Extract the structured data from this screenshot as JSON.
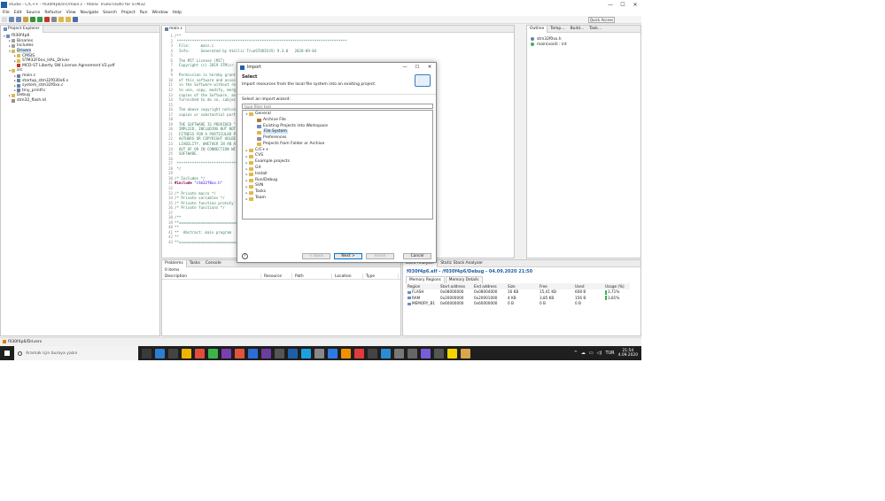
{
  "window": {
    "title": "studio - C/C++ - f030f4p6/src/main.c - Atollic TrueSTUDIO for STM32",
    "minimize": "—",
    "maximize": "☐",
    "close": "✕"
  },
  "menu": [
    "File",
    "Edit",
    "Source",
    "Refactor",
    "View",
    "Navigate",
    "Search",
    "Project",
    "Run",
    "Window",
    "Help"
  ],
  "quick_access": "Quick Access",
  "project_explorer": {
    "tab_label": "Project Explorer",
    "tree": [
      {
        "indent": 0,
        "twisty": "▾",
        "label": "f030f4p6",
        "icon": "project-icon",
        "color": "#6b8cc7"
      },
      {
        "indent": 1,
        "twisty": "▸",
        "label": "Binaries",
        "icon": "binaries-icon",
        "color": "#a0a0a0"
      },
      {
        "indent": 1,
        "twisty": "▸",
        "label": "Includes",
        "icon": "includes-icon",
        "color": "#a0a0a0"
      },
      {
        "indent": 1,
        "twisty": "▾",
        "label": "Drivers",
        "icon": "folder-icon",
        "color": "#e0b84a",
        "selected": true
      },
      {
        "indent": 2,
        "twisty": "▸",
        "label": "CMSIS",
        "icon": "folder-icon",
        "color": "#e0b84a"
      },
      {
        "indent": 2,
        "twisty": "▸",
        "label": "STM32F0xx_HAL_Driver",
        "icon": "folder-icon",
        "color": "#e0b84a"
      },
      {
        "indent": 2,
        "twisty": "",
        "label": "MCD-ST Liberty SW License Agreement V2.pdf",
        "icon": "pdf-icon",
        "color": "#c0392b"
      },
      {
        "indent": 1,
        "twisty": "▾",
        "label": "src",
        "icon": "folder-icon",
        "color": "#e0b84a"
      },
      {
        "indent": 2,
        "twisty": "▸",
        "label": "main.c",
        "icon": "c-file-icon",
        "color": "#6a7fa8"
      },
      {
        "indent": 2,
        "twisty": "▸",
        "label": "startup_stm32f030x6.s",
        "icon": "asm-file-icon",
        "color": "#6a7fa8"
      },
      {
        "indent": 2,
        "twisty": "▸",
        "label": "system_stm32f0xx.c",
        "icon": "c-file-icon",
        "color": "#6a7fa8"
      },
      {
        "indent": 2,
        "twisty": "▸",
        "label": "tiny_printf.c",
        "icon": "c-file-icon",
        "color": "#6a7fa8"
      },
      {
        "indent": 1,
        "twisty": "▸",
        "label": "Debug",
        "icon": "folder-icon",
        "color": "#e0b84a"
      },
      {
        "indent": 1,
        "twisty": "",
        "label": "stm32_flash.ld",
        "icon": "ld-file-icon",
        "color": "#8f8f8f"
      }
    ]
  },
  "editor": {
    "tab_label": "main.c",
    "lines": [
      {
        "n": "1",
        "parts": [
          {
            "c": "cm",
            "t": "/**"
          }
        ]
      },
      {
        "n": "2",
        "parts": [
          {
            "c": "cm",
            "t": " ******************************************************************************"
          }
        ]
      },
      {
        "n": "3",
        "parts": [
          {
            "c": "cm",
            "t": "  File:     main.c"
          }
        ]
      },
      {
        "n": "4",
        "parts": [
          {
            "c": "cm",
            "t": "  Info:     Generated by Atollic TrueSTUDIO(R) 9.3.0   2020-09-04"
          }
        ]
      },
      {
        "n": "5",
        "parts": [
          {
            "c": "cm",
            "t": ""
          }
        ]
      },
      {
        "n": "6",
        "parts": [
          {
            "c": "cm",
            "t": "  The MIT License (MIT)"
          }
        ]
      },
      {
        "n": "7",
        "parts": [
          {
            "c": "cm",
            "t": "  Copyright (c) 2019 STMicr"
          }
        ]
      },
      {
        "n": "8",
        "parts": [
          {
            "c": "cm",
            "t": ""
          }
        ]
      },
      {
        "n": "9",
        "parts": [
          {
            "c": "cm",
            "t": "  Permission is hereby grant"
          }
        ]
      },
      {
        "n": "10",
        "parts": [
          {
            "c": "cm",
            "t": "  of this software and assoc"
          }
        ]
      },
      {
        "n": "11",
        "parts": [
          {
            "c": "cm",
            "t": "  in the Software without re"
          }
        ]
      },
      {
        "n": "12",
        "parts": [
          {
            "c": "cm",
            "t": "  to use, copy, modify, merg"
          }
        ]
      },
      {
        "n": "13",
        "parts": [
          {
            "c": "cm",
            "t": "  copies of the Software, an"
          }
        ]
      },
      {
        "n": "14",
        "parts": [
          {
            "c": "cm",
            "t": "  furnished to do so, subjec"
          }
        ]
      },
      {
        "n": "15",
        "parts": [
          {
            "c": "cm",
            "t": ""
          }
        ]
      },
      {
        "n": "16",
        "parts": [
          {
            "c": "cm",
            "t": "  The above copyright notice"
          }
        ]
      },
      {
        "n": "17",
        "parts": [
          {
            "c": "cm",
            "t": "  copies or substantial port"
          }
        ]
      },
      {
        "n": "18",
        "parts": [
          {
            "c": "cm",
            "t": ""
          }
        ]
      },
      {
        "n": "19",
        "parts": [
          {
            "c": "cm",
            "t": "  THE SOFTWARE IS PROVIDED \""
          }
        ]
      },
      {
        "n": "20",
        "parts": [
          {
            "c": "cm",
            "t": "  IMPLIED, INCLUDING BUT NOT"
          }
        ]
      },
      {
        "n": "21",
        "parts": [
          {
            "c": "cm",
            "t": "  FITNESS FOR A PARTICULAR P"
          }
        ]
      },
      {
        "n": "22",
        "parts": [
          {
            "c": "cm",
            "t": "  AUTHORS OR COPYRIGHT HOLDE"
          }
        ]
      },
      {
        "n": "23",
        "parts": [
          {
            "c": "cm",
            "t": "  LIABILITY, WHETHER IN AN A"
          }
        ]
      },
      {
        "n": "24",
        "parts": [
          {
            "c": "cm",
            "t": "  OUT OF OR IN CONNECTION WI"
          }
        ]
      },
      {
        "n": "25",
        "parts": [
          {
            "c": "cm",
            "t": "  SOFTWARE."
          }
        ]
      },
      {
        "n": "26",
        "parts": [
          {
            "c": "cm",
            "t": ""
          }
        ]
      },
      {
        "n": "27",
        "parts": [
          {
            "c": "cm",
            "t": " ******************************************************************************"
          }
        ]
      },
      {
        "n": "28",
        "parts": [
          {
            "c": "cm",
            "t": " */"
          }
        ]
      },
      {
        "n": "29",
        "parts": [
          {
            "c": "",
            "t": ""
          }
        ]
      },
      {
        "n": "30",
        "parts": [
          {
            "c": "cm",
            "t": "/* Includes */"
          }
        ]
      },
      {
        "n": "31",
        "parts": [
          {
            "c": "kw",
            "t": "#include "
          },
          {
            "c": "st",
            "t": "\"stm32f0xx.h\""
          }
        ]
      },
      {
        "n": "32",
        "parts": [
          {
            "c": "",
            "t": ""
          }
        ]
      },
      {
        "n": "33",
        "parts": [
          {
            "c": "cm",
            "t": "/* Private macro */"
          }
        ]
      },
      {
        "n": "34",
        "parts": [
          {
            "c": "cm",
            "t": "/* Private variables */"
          }
        ]
      },
      {
        "n": "35",
        "parts": [
          {
            "c": "cm",
            "t": "/* Private function prototy"
          }
        ]
      },
      {
        "n": "36",
        "parts": [
          {
            "c": "cm",
            "t": "/* Private functions */"
          }
        ]
      },
      {
        "n": "37",
        "parts": [
          {
            "c": "",
            "t": ""
          }
        ]
      },
      {
        "n": "38",
        "parts": [
          {
            "c": "cm",
            "t": "/**"
          }
        ]
      },
      {
        "n": "39",
        "parts": [
          {
            "c": "cm",
            "t": "**==========================="
          }
        ]
      },
      {
        "n": "40",
        "parts": [
          {
            "c": "cm",
            "t": "**"
          }
        ]
      },
      {
        "n": "41",
        "parts": [
          {
            "c": "cm",
            "t": "**  Abstract: main program"
          }
        ]
      },
      {
        "n": "42",
        "parts": [
          {
            "c": "cm",
            "t": "**"
          }
        ]
      },
      {
        "n": "43",
        "parts": [
          {
            "c": "cm",
            "t": "**==========================="
          }
        ]
      }
    ]
  },
  "outline": {
    "tabs": [
      "Outline",
      "Temp...",
      "Build...",
      "Task..."
    ],
    "items": [
      {
        "label": "stm32f0xx.h",
        "icon": "include-icon",
        "color": "#6a7fa8"
      },
      {
        "label": "main(void) : int",
        "icon": "function-icon",
        "color": "#3cb44b"
      }
    ]
  },
  "problems": {
    "tabs": [
      "Problems",
      "Tasks",
      "Console"
    ],
    "count": "0 items",
    "columns": [
      "Description",
      "Resource",
      "Path",
      "Location",
      "Type"
    ]
  },
  "memory": {
    "tabs": [
      "Build Analyzer",
      "Static Stack Analyzer"
    ],
    "title": "f030f4p6.elf - /f030f4p6/Debug - 04.09.2020 21:50",
    "subtabs": [
      "Memory Regions",
      "Memory Details"
    ],
    "columns": [
      "Region",
      "Start address",
      "End address",
      "Size",
      "Free",
      "Used",
      "Usage (%)"
    ],
    "rows": [
      {
        "region": "FLASH",
        "start": "0x08000000",
        "end": "0x08004000",
        "size": "16 KB",
        "free": "15,41 KB",
        "used": "608 B",
        "usage": "3,71%"
      },
      {
        "region": "RAM",
        "start": "0x20000000",
        "end": "0x20001000",
        "size": "4 KB",
        "free": "3,85 KB",
        "used": "156 B",
        "usage": "3,81%"
      },
      {
        "region": "MEMORY_B1",
        "start": "0x60000000",
        "end": "0x60000000",
        "size": "0 B",
        "free": "0 B",
        "used": "0 B",
        "usage": ""
      }
    ]
  },
  "status": "f030f4p6/Drivers",
  "dialog": {
    "title": "Import",
    "header": "Select",
    "description": "Import resources from the local file system into an existing project.",
    "wizard_label": "Select an import wizard:",
    "filter_placeholder": "type filter text",
    "tree": [
      {
        "indent": 0,
        "twisty": "▾",
        "label": "General",
        "icon": "folder-icon",
        "color": "#e0b84a"
      },
      {
        "indent": 1,
        "twisty": "",
        "label": "Archive File",
        "icon": "archive-icon",
        "color": "#b07a3a"
      },
      {
        "indent": 1,
        "twisty": "",
        "label": "Existing Projects into Workspace",
        "icon": "projects-icon",
        "color": "#6b8cc7"
      },
      {
        "indent": 1,
        "twisty": "",
        "label": "File System",
        "icon": "file-system-icon",
        "color": "#e0b84a",
        "selected": true
      },
      {
        "indent": 1,
        "twisty": "",
        "label": "Preferences",
        "icon": "preferences-icon",
        "color": "#8f8f8f"
      },
      {
        "indent": 1,
        "twisty": "",
        "label": "Projects from Folder or Archive",
        "icon": "folder-archive-icon",
        "color": "#e0b84a"
      },
      {
        "indent": 0,
        "twisty": "▸",
        "label": "C/C++",
        "icon": "folder-icon",
        "color": "#e0b84a"
      },
      {
        "indent": 0,
        "twisty": "▸",
        "label": "CVS",
        "icon": "folder-icon",
        "color": "#e0b84a"
      },
      {
        "indent": 0,
        "twisty": "▸",
        "label": "Example projects",
        "icon": "folder-icon",
        "color": "#e0b84a"
      },
      {
        "indent": 0,
        "twisty": "▸",
        "label": "Git",
        "icon": "folder-icon",
        "color": "#e0b84a"
      },
      {
        "indent": 0,
        "twisty": "▸",
        "label": "Install",
        "icon": "folder-icon",
        "color": "#e0b84a"
      },
      {
        "indent": 0,
        "twisty": "▸",
        "label": "Run/Debug",
        "icon": "folder-icon",
        "color": "#e0b84a"
      },
      {
        "indent": 0,
        "twisty": "▸",
        "label": "SVN",
        "icon": "folder-icon",
        "color": "#e0b84a"
      },
      {
        "indent": 0,
        "twisty": "▸",
        "label": "Tasks",
        "icon": "folder-icon",
        "color": "#e0b84a"
      },
      {
        "indent": 0,
        "twisty": "▸",
        "label": "Team",
        "icon": "folder-icon",
        "color": "#e0b84a"
      }
    ],
    "buttons": {
      "back": "< Back",
      "next": "Next >",
      "finish": "Finish",
      "cancel": "Cancel"
    },
    "help": "?"
  },
  "taskbar": {
    "search_placeholder": "Aramak için buraya yazın",
    "apps": [
      "#3a3a3a",
      "#2d7dd2",
      "#444",
      "#f0b400",
      "#e24c3b",
      "#3cb44b",
      "#7a3fb0",
      "#e0543b",
      "#2c6ed6",
      "#6a3ea1",
      "#555",
      "#1f5fa8",
      "#1ba1e2",
      "#888",
      "#2c7be5",
      "#f29100",
      "#e03b3b",
      "#444",
      "#2a8dd4",
      "#777",
      "#666",
      "#7a5bd8",
      "#555",
      "#f3d400",
      "#d9a64a"
    ],
    "tray_icons": [
      "^",
      "☁",
      "▭",
      "◁)",
      "TUR"
    ],
    "time": "21:54",
    "date": "4.09.2020"
  },
  "colors": {
    "accent": "#0078d7",
    "selection": "#cce4f7",
    "usage_bar": "#3cb44b"
  }
}
